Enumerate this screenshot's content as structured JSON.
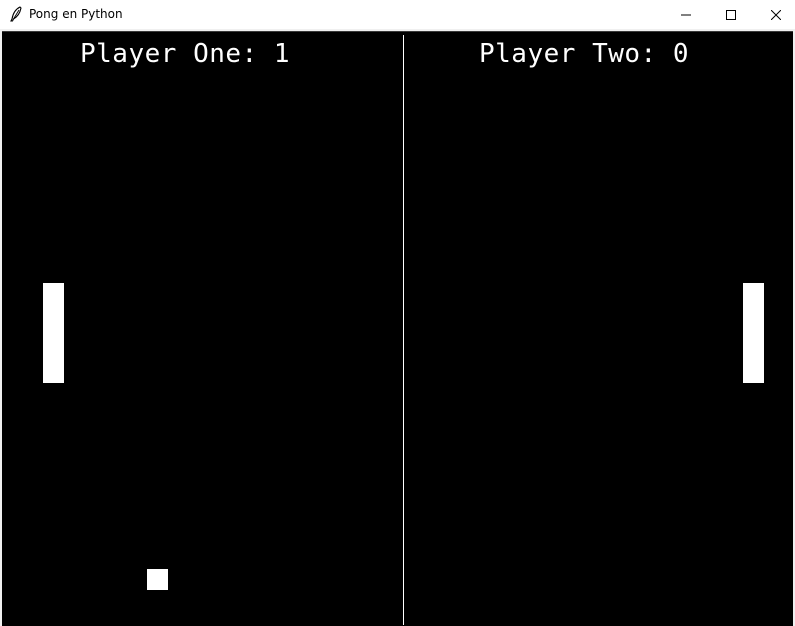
{
  "window": {
    "title": "Pong en Python",
    "icon": "feather-icon",
    "controls": [
      "minimize-icon",
      "maximize-icon",
      "close-icon"
    ]
  },
  "game": {
    "background_color": "#000000",
    "foreground_color": "#ffffff",
    "player_one": {
      "label": "Player One",
      "score": 1,
      "score_text": "Player One: 1"
    },
    "player_two": {
      "label": "Player Two",
      "score": 0,
      "score_text": "Player Two: 0"
    }
  }
}
